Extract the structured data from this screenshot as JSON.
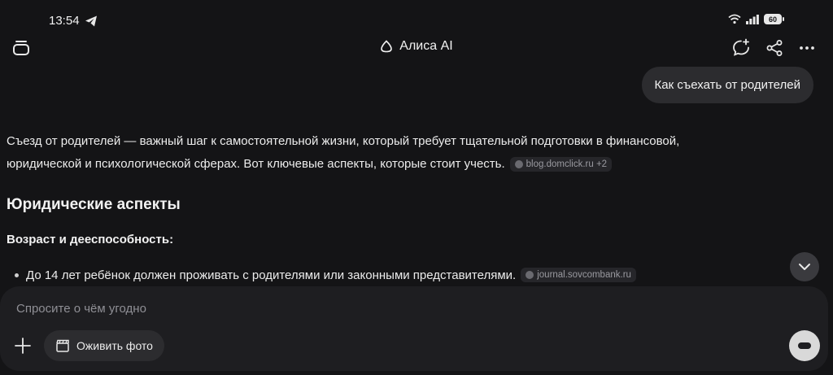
{
  "status_bar": {
    "time": "13:54",
    "battery": "60"
  },
  "header": {
    "title": "Алиса AI"
  },
  "chat": {
    "user_message": "Как съехать от родителей",
    "answer": {
      "intro_line1": "Съезд от родителей — важный шаг к самостоятельной жизни, который требует тщательной подготовки в финансовой,",
      "intro_line2": "юридической и психологической сферах. Вот ключевые аспекты, которые стоит учесть.",
      "intro_source": "blog.domclick.ru +2",
      "section_title": "Юридические аспекты",
      "subsection_title": "Возраст и дееспособность:",
      "bullet_text": "До 14 лет ребёнок должен проживать с родителями или законными представителями.",
      "bullet_source": "journal.sovcombank.ru"
    }
  },
  "composer": {
    "placeholder": "Спросите о чём угодно",
    "photo_button_label": "Оживить фото"
  }
}
